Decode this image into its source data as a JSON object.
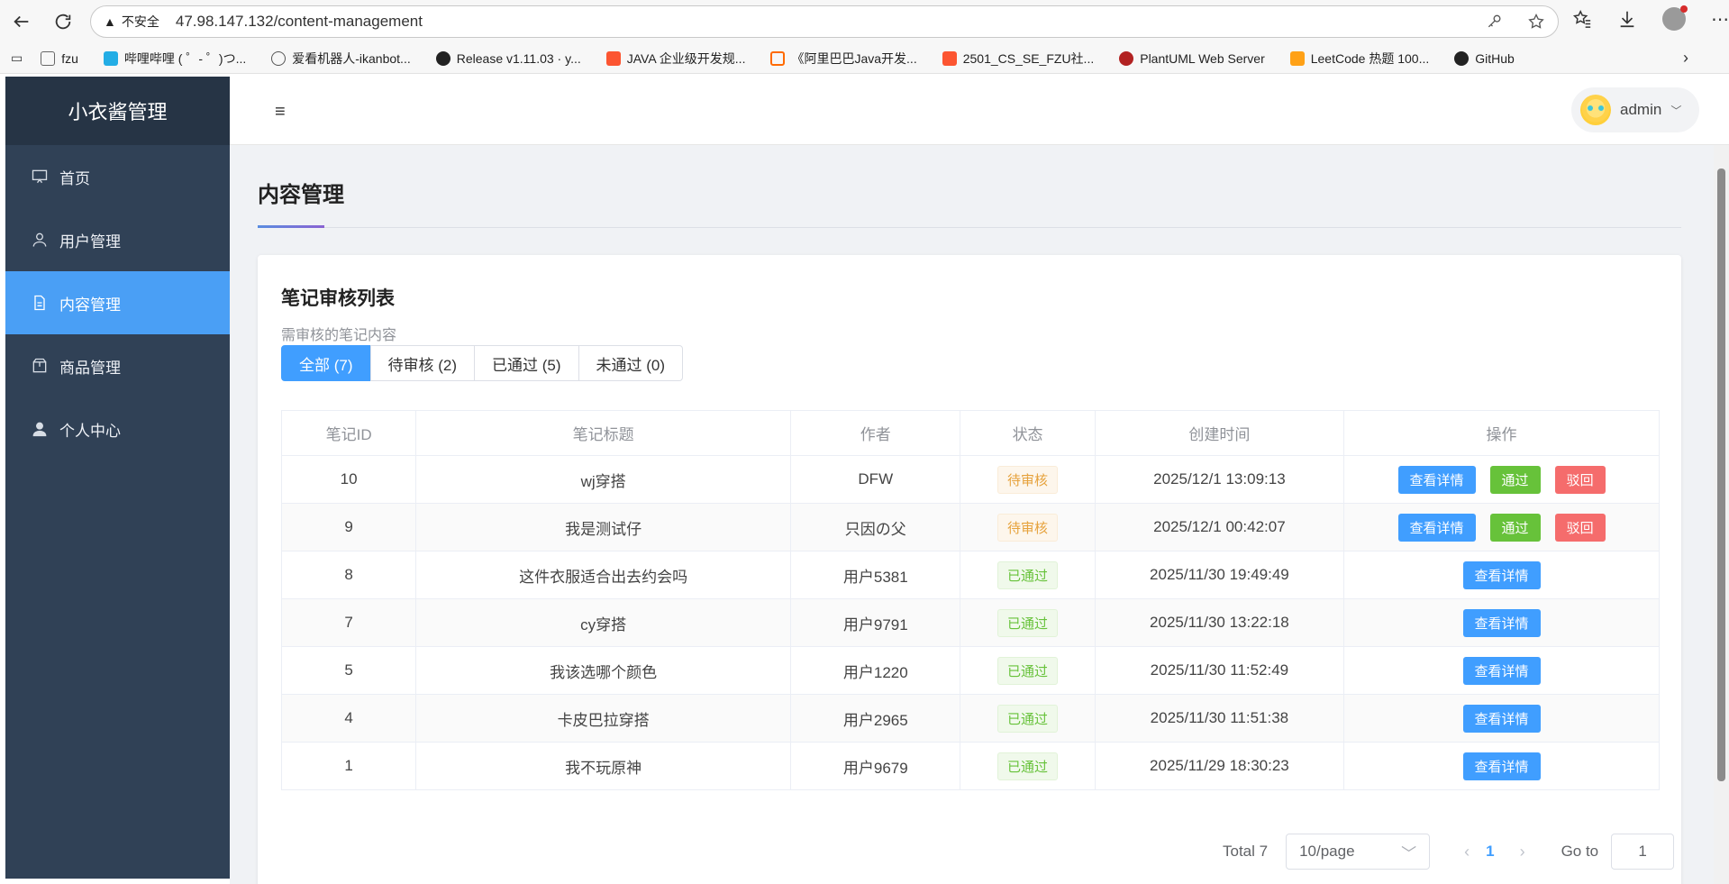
{
  "browser": {
    "insecure_label": "不安全",
    "url": "47.98.147.132/content-management"
  },
  "bookmarks": [
    {
      "label": "fzu",
      "color": "#666666"
    },
    {
      "label": "哔哩哔哩 ( ゜- ゜)つ...",
      "color": "#23ade5"
    },
    {
      "label": "爱看机器人-ikanbot...",
      "color": "#555555"
    },
    {
      "label": "Release v1.11.03 · y...",
      "color": "#222222"
    },
    {
      "label": "JAVA 企业级开发规...",
      "color": "#fc5531"
    },
    {
      "label": "《阿里巴巴Java开发...",
      "color": "#ff6a00"
    },
    {
      "label": "2501_CS_SE_FZU社...",
      "color": "#fc5531"
    },
    {
      "label": "PlantUML Web Server",
      "color": "#b22222"
    },
    {
      "label": "LeetCode 热题 100...",
      "color": "#ffa116"
    },
    {
      "label": "GitHub",
      "color": "#222222"
    }
  ],
  "sidebar": {
    "brand": "小衣酱管理",
    "items": [
      {
        "label": "首页",
        "icon": "monitor-icon"
      },
      {
        "label": "用户管理",
        "icon": "user-icon"
      },
      {
        "label": "内容管理",
        "icon": "document-icon",
        "active": true
      },
      {
        "label": "商品管理",
        "icon": "box-icon"
      },
      {
        "label": "个人中心",
        "icon": "person-icon"
      }
    ]
  },
  "header": {
    "user_name": "admin"
  },
  "page": {
    "title": "内容管理",
    "card_title": "笔记审核列表",
    "card_subtitle": "需审核的笔记内容",
    "tabs": [
      "全部 (7)",
      "待审核 (2)",
      "已通过 (5)",
      "未通过 (0)"
    ]
  },
  "table": {
    "headers": [
      "笔记ID",
      "笔记标题",
      "作者",
      "状态",
      "创建时间",
      "操作"
    ],
    "rows": [
      {
        "id": "10",
        "title": "wj穿搭",
        "author": "DFW",
        "status": "待审核",
        "time": "2025/12/1 13:09:13"
      },
      {
        "id": "9",
        "title": "我是测试仔",
        "author": "只因の父",
        "status": "待审核",
        "time": "2025/12/1 00:42:07"
      },
      {
        "id": "8",
        "title": "这件衣服适合出去约会吗",
        "author": "用户5381",
        "status": "已通过",
        "time": "2025/11/30 19:49:49"
      },
      {
        "id": "7",
        "title": "cy穿搭",
        "author": "用户9791",
        "status": "已通过",
        "time": "2025/11/30 13:22:18"
      },
      {
        "id": "5",
        "title": "我该选哪个颜色",
        "author": "用户1220",
        "status": "已通过",
        "time": "2025/11/30 11:52:49"
      },
      {
        "id": "4",
        "title": "卡皮巴拉穿搭",
        "author": "用户2965",
        "status": "已通过",
        "time": "2025/11/30 11:51:38"
      },
      {
        "id": "1",
        "title": "我不玩原神",
        "author": "用户9679",
        "status": "已通过",
        "time": "2025/11/29 18:30:23"
      }
    ],
    "actions": {
      "view": "查看详情",
      "pass": "通过",
      "reject": "驳回"
    }
  },
  "pagination": {
    "total": "Total 7",
    "page_size": "10/page",
    "current": "1",
    "goto_label": "Go to",
    "goto_value": "1"
  }
}
